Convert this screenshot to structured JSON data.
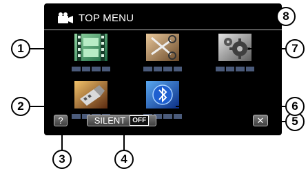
{
  "menu": {
    "title": "TOP MENU",
    "title_icon": "video-camera-icon"
  },
  "tiles": [
    {
      "icon": "film-strip-icon"
    },
    {
      "icon": "usb-connection-icon"
    },
    {
      "icon": "edit-scissors-icon"
    },
    {
      "icon": "bluetooth-icon"
    },
    {
      "icon": "settings-gears-icon"
    }
  ],
  "buttons": {
    "help_label": "?",
    "silent_label": "SILENT",
    "silent_state": "OFF",
    "close_label": "✕"
  },
  "callouts": [
    "1",
    "2",
    "3",
    "4",
    "5",
    "6",
    "7",
    "8"
  ],
  "colors": {
    "screen": "#000000",
    "button": "#5a5a5a",
    "label_bar": "#4a5a7a"
  }
}
